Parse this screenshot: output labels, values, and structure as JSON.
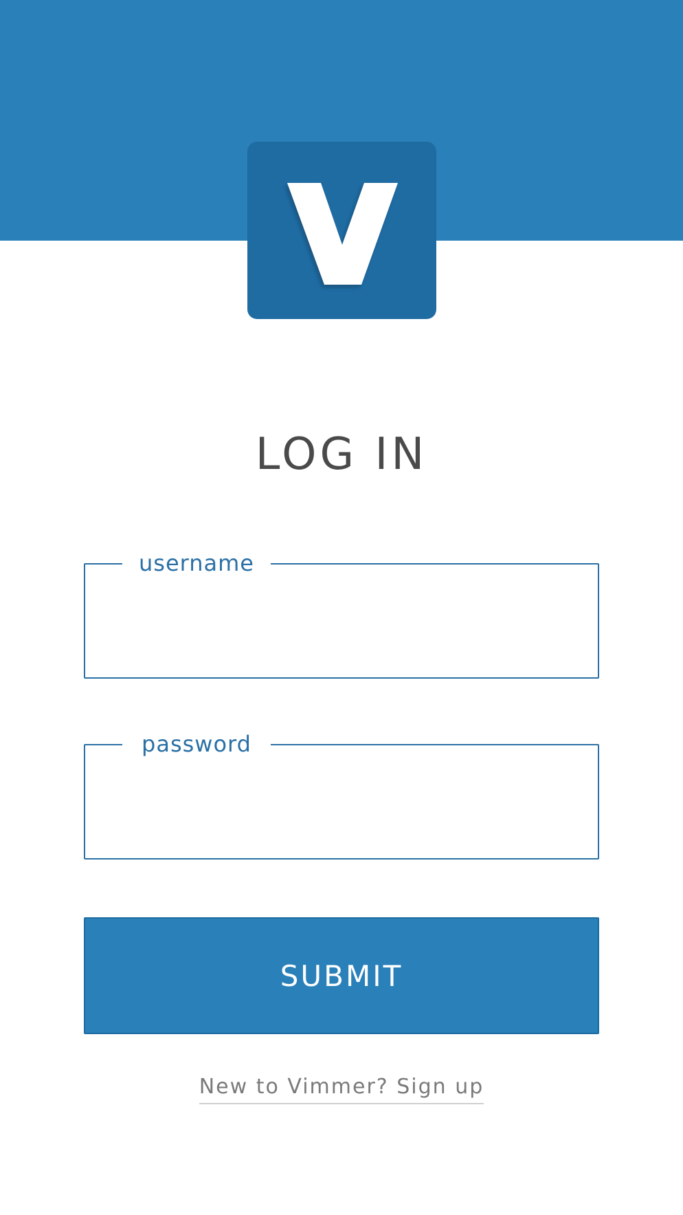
{
  "header": {
    "logo_letter": "V",
    "accent_color": "#2a80b9",
    "logo_bg_color": "#1f6ca3"
  },
  "page": {
    "title": "LOG IN"
  },
  "form": {
    "username": {
      "label": "username",
      "value": "",
      "placeholder": ""
    },
    "password": {
      "label": "password",
      "value": "",
      "placeholder": ""
    },
    "submit_label": "SUBMIT"
  },
  "footer": {
    "signup_text": "New to Vimmer? Sign up"
  }
}
